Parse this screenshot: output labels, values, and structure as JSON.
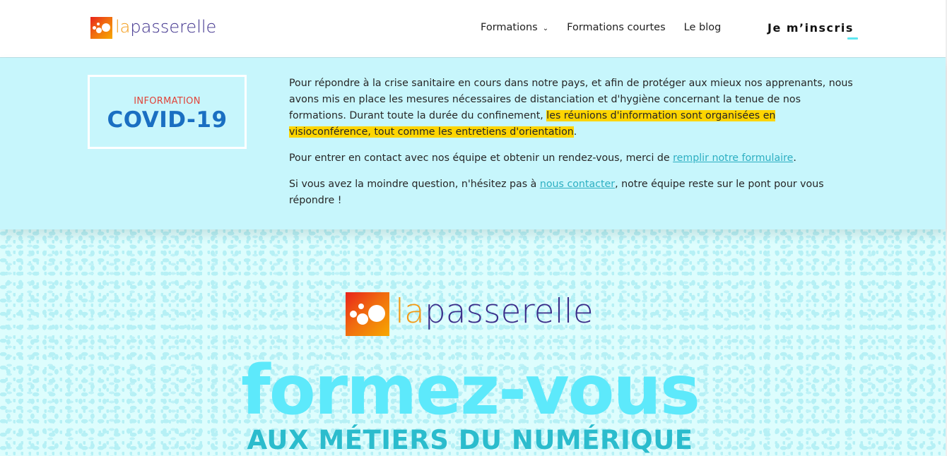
{
  "header": {
    "logo": {
      "part1": "la",
      "part2": "passerelle"
    },
    "nav": [
      {
        "label": "Formations",
        "has_dropdown": true
      },
      {
        "label": "Formations courtes",
        "has_dropdown": false
      },
      {
        "label": "Le blog",
        "has_dropdown": false
      }
    ],
    "signup_label": "Je m’inscris",
    "dropdown_glyph": "⌄"
  },
  "banner": {
    "kicker": "INFORMATION",
    "title": "COVID-19",
    "p1_before": "Pour répondre à la crise sanitaire en cours dans notre pays, et afin de protéger aux mieux nos apprenants, nous avons mis en place les mesures nécessaires de distanciation et d'hygiène concernant la tenue de nos formations. Durant toute la durée du confinement, ",
    "p1_highlight": "les réunions d'information sont organisées en visioconférence, tout comme les entretiens d'orientation",
    "p1_after": ".",
    "p2_before": "Pour entrer en contact avec nos équipe et obtenir un rendez-vous, merci de ",
    "p2_link": "remplir notre formulaire",
    "p2_after": ".",
    "p3_before": "Si vous avez la moindre question, n'hésitez pas à ",
    "p3_link": "nous contacter",
    "p3_after": ", notre équipe reste sur le pont pour vous répondre !"
  },
  "hero": {
    "logo": {
      "part1": "la",
      "part2": "passerelle"
    },
    "title": "formez-vous",
    "subtitle": "AUX MÉTIERS DU NUMÉRIQUE"
  },
  "colors": {
    "brand_orange": "#f39a15",
    "brand_purple": "#3b2d8a",
    "banner_bg": "#c7f6fc",
    "highlight": "#fed500",
    "link": "#2dafc2",
    "covid_red": "#e0443a",
    "covid_blue": "#1a6fc2",
    "hero_title": "#5de9fb",
    "hero_sub": "#2bbccd"
  }
}
